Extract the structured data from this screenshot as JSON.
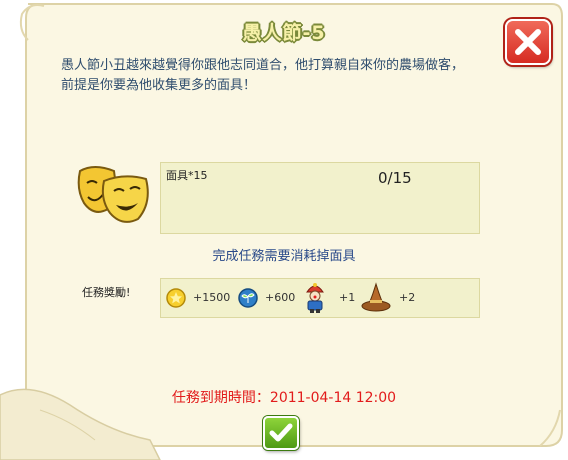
{
  "dialog": {
    "title": "愚人節-5",
    "description_line1": "愚人節小丑越來越覺得你跟他志同道合，他打算親自來你的農場做客，",
    "description_line2": "前提是你要為他收集更多的面具！",
    "requirement": {
      "item_label": "面具*15",
      "progress": "0/15",
      "icon": "theater-masks-icon"
    },
    "consume_note": "完成任務需要消耗掉面具",
    "reward_label": "任務獎勵!",
    "rewards": [
      {
        "icon": "gold-coin-icon",
        "value": "+1500"
      },
      {
        "icon": "experience-icon",
        "value": "+600"
      },
      {
        "icon": "clown-icon",
        "value": "+1"
      },
      {
        "icon": "hat-icon",
        "value": "+2"
      }
    ],
    "deadline": "任務到期時間：2011-04-14 12:00",
    "close_icon": "close-x-icon",
    "confirm_icon": "checkmark-icon"
  }
}
